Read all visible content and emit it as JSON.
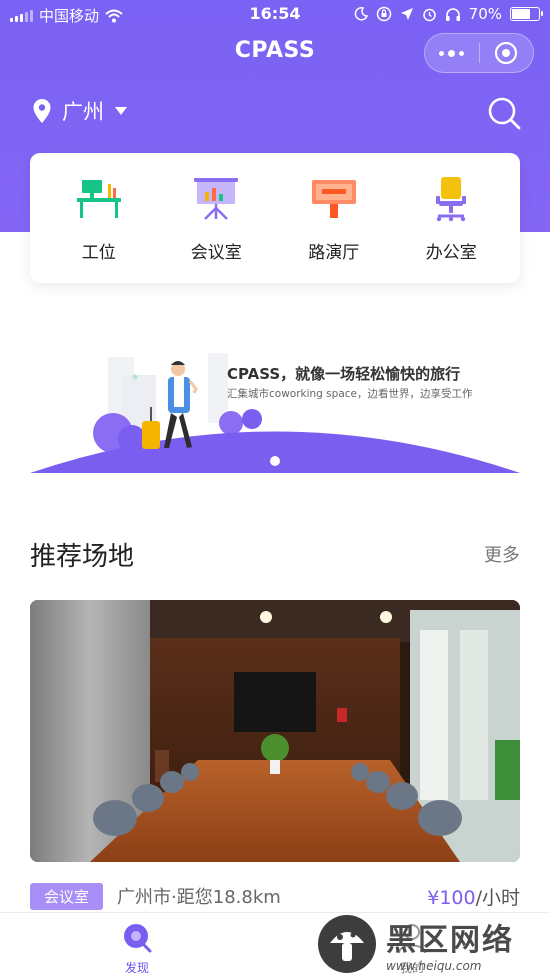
{
  "colors": {
    "brand": "#7a62f4",
    "price": "#7d5cf0",
    "tag": "#a88ff7"
  },
  "status": {
    "carrier": "中国移动",
    "time": "16:54",
    "battery": "70%",
    "battery_level": 0.7,
    "icons": [
      "wifi-icon",
      "moon-icon",
      "lock-rotation-icon",
      "location-arrow-icon",
      "alarm-icon",
      "headphones-icon",
      "battery-icon"
    ]
  },
  "header": {
    "title": "CPASS",
    "capsule_icons": [
      "more-dots-icon",
      "close-target-icon"
    ]
  },
  "location": {
    "city": "广州",
    "icon": "location-pin-icon",
    "dropdown_icon": "caret-down-icon",
    "search_icon": "search-icon"
  },
  "categories": [
    {
      "label": "工位",
      "icon": "workstation-desk-icon"
    },
    {
      "label": "会议室",
      "icon": "meeting-board-icon"
    },
    {
      "label": "路演厅",
      "icon": "roadshow-hall-icon"
    },
    {
      "label": "办公室",
      "icon": "office-chair-icon"
    }
  ],
  "banner": {
    "title": "CPASS，就像一场轻松愉快的旅行",
    "subtitle": "汇集城市coworking space，边看世界，边享受工作"
  },
  "section": {
    "title": "推荐场地",
    "more": "更多"
  },
  "venue": {
    "tag": "会议室",
    "location": "广州市·距您18.8km",
    "price": "¥100",
    "unit": "/小时"
  },
  "tabbar": {
    "tabs": [
      {
        "label": "发现",
        "icon": "discover-icon",
        "active": true
      },
      {
        "label": "我的",
        "icon": "profile-icon",
        "active": false
      }
    ]
  },
  "watermark": {
    "text": "黑区网络",
    "url": "www.heiqu.com"
  }
}
